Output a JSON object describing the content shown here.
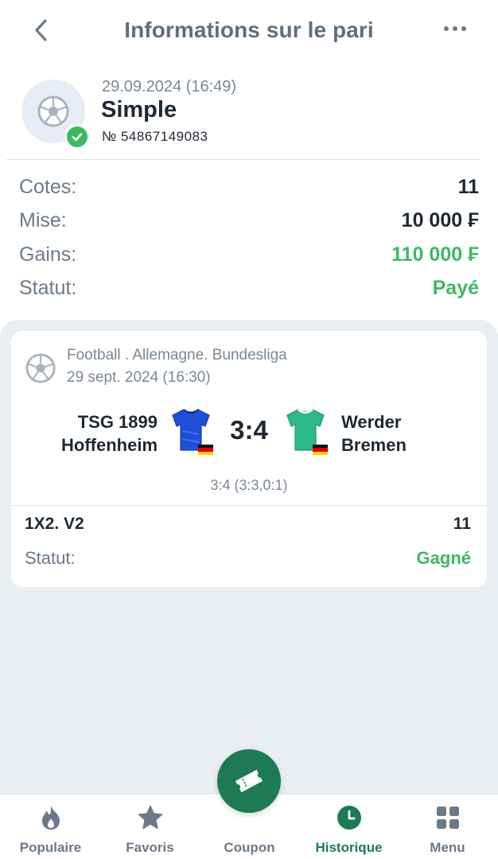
{
  "header": {
    "title": "Informations sur le pari"
  },
  "bet": {
    "datetime": "29.09.2024 (16:49)",
    "type": "Simple",
    "number": "№ 54867149083"
  },
  "summary": [
    {
      "label": "Cotes:",
      "value": "11"
    },
    {
      "label": "Mise:",
      "value": "10 000 ₣"
    },
    {
      "label": "Gains:",
      "value": "110 000 ₣"
    },
    {
      "label": "Statut:",
      "value": "Payé"
    }
  ],
  "event": {
    "league": "Football . Allemagne. Bundesliga",
    "date": "29 sept. 2024 (16:30)",
    "home_team_line1": "TSG 1899",
    "home_team_line2": "Hoffenheim",
    "away_team_line1": "Werder",
    "away_team_line2": "Bremen",
    "score": "3:4",
    "score_detail": "3:4 (3:3,0:1)",
    "market": "1X2. V2",
    "market_odds": "11",
    "status_label": "Statut:",
    "status_value": "Gagné"
  },
  "colors": {
    "accent_green": "#3fb861",
    "brand_green": "#1e7a55",
    "home_jersey": "#1f4fd6",
    "away_jersey": "#2bb88a"
  },
  "nav": [
    {
      "label": "Populaire",
      "icon": "flame-icon"
    },
    {
      "label": "Favoris",
      "icon": "star-icon"
    },
    {
      "label": "Coupon",
      "icon": "ticket-icon"
    },
    {
      "label": "Historique",
      "icon": "clock-icon",
      "active": true
    },
    {
      "label": "Menu",
      "icon": "grid-icon"
    }
  ]
}
